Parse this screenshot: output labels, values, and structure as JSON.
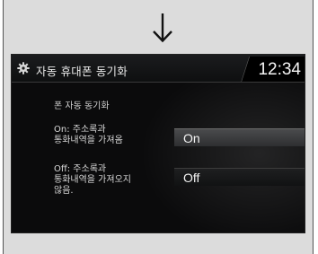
{
  "screen": {
    "title": "자동 휴대폰 동기화",
    "clock": "12:34",
    "subtitle": "폰 자동 동기화",
    "options": [
      {
        "label_lines": [
          "On: 주소록과",
          "통화내역을 가져옴"
        ],
        "button": "On",
        "selected": true
      },
      {
        "label_lines": [
          "Off: 주소록과",
          "통화내역을 가져오지",
          "않음."
        ],
        "button": "Off",
        "selected": false
      }
    ]
  },
  "icons": {
    "arrow": "down-arrow-icon",
    "settings": "gear-icon"
  },
  "colors": {
    "screen_bg": "#0b0b0c",
    "frame_bg": "#dcdcdc",
    "selected_button": "#3c3d3f",
    "text": "#e8e8e8"
  }
}
